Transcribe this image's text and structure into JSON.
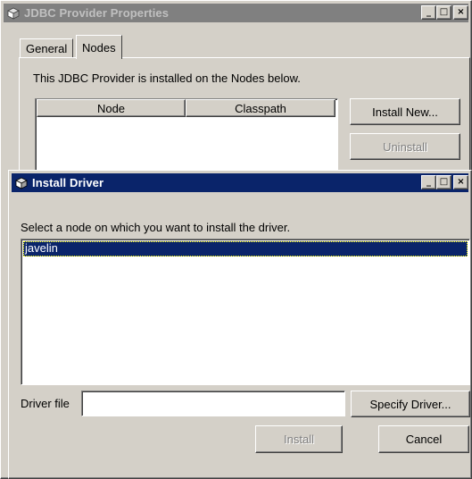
{
  "outer_window": {
    "title": "JDBC Provider Properties",
    "tabs": [
      {
        "label": "General"
      },
      {
        "label": "Nodes"
      }
    ],
    "description": "This JDBC Provider is installed on the Nodes below.",
    "table": {
      "columns": [
        "Node",
        "Classpath"
      ]
    },
    "buttons": {
      "install_new": "Install New...",
      "uninstall": "Uninstall"
    },
    "window_controls": {
      "minimize": "_",
      "maximize": "□",
      "close": "×"
    }
  },
  "dialog": {
    "title": "Install Driver",
    "prompt": "Select a node on which you want to install the driver.",
    "nodes": [
      {
        "label": "javelin",
        "selected": true
      }
    ],
    "driver_file_label": "Driver file",
    "driver_file_value": "",
    "buttons": {
      "specify_driver": "Specify Driver...",
      "install": "Install",
      "cancel": "Cancel"
    },
    "window_controls": {
      "minimize": "_",
      "maximize": "□",
      "close": "×"
    }
  },
  "colors": {
    "active_title": "#0a246a",
    "inactive_title": "#808080",
    "face": "#d4d0c8"
  }
}
